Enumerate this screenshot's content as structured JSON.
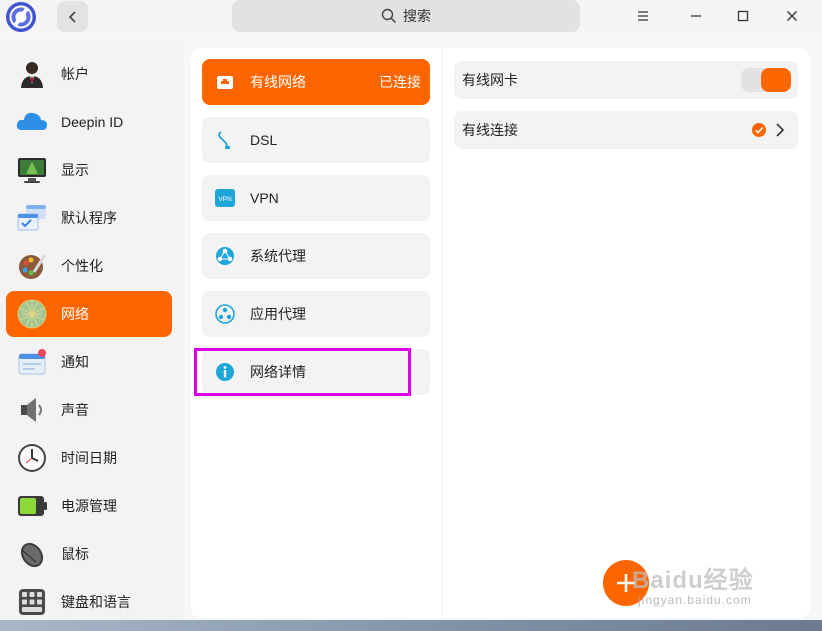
{
  "titlebar": {
    "search_label": "搜索",
    "icons": [
      "deepin-logo-icon",
      "chevron-left-icon",
      "search-icon",
      "menu-icon",
      "minimize-icon",
      "maximize-icon",
      "close-icon"
    ]
  },
  "sidebar": {
    "items": [
      {
        "label": "帐户",
        "icon": "user-avatar-icon"
      },
      {
        "label": "Deepin ID",
        "icon": "cloud-icon"
      },
      {
        "label": "显示",
        "icon": "monitor-icon"
      },
      {
        "label": "默认程序",
        "icon": "default-apps-icon"
      },
      {
        "label": "个性化",
        "icon": "palette-icon"
      },
      {
        "label": "网络",
        "icon": "globe-network-icon",
        "active": true
      },
      {
        "label": "通知",
        "icon": "notification-icon"
      },
      {
        "label": "声音",
        "icon": "speaker-icon"
      },
      {
        "label": "时间日期",
        "icon": "clock-icon"
      },
      {
        "label": "电源管理",
        "icon": "battery-icon"
      },
      {
        "label": "鼠标",
        "icon": "mouse-icon"
      },
      {
        "label": "键盘和语言",
        "icon": "keyboard-icon"
      }
    ]
  },
  "network_menu": {
    "items": [
      {
        "label": "有线网络",
        "status": "已连接",
        "icon": "wired-network-icon",
        "active": true
      },
      {
        "label": "DSL",
        "icon": "dsl-icon"
      },
      {
        "label": "VPN",
        "icon": "vpn-icon",
        "icon_text": "VPN"
      },
      {
        "label": "系统代理",
        "icon": "system-proxy-icon"
      },
      {
        "label": "应用代理",
        "icon": "app-proxy-icon"
      },
      {
        "label": "网络详情",
        "icon": "info-icon",
        "highlighted": true
      }
    ]
  },
  "wired_panel": {
    "card_label": "有线网卡",
    "card_enabled": true,
    "connection_label": "有线连接",
    "connection_selected": true
  },
  "watermark": {
    "brand": "Baidu经验",
    "url": "jingyan.baidu.com"
  },
  "colors": {
    "accent": "#fc6500",
    "highlight_box": "#e000e8",
    "info_icon": "#1fa6d9"
  }
}
